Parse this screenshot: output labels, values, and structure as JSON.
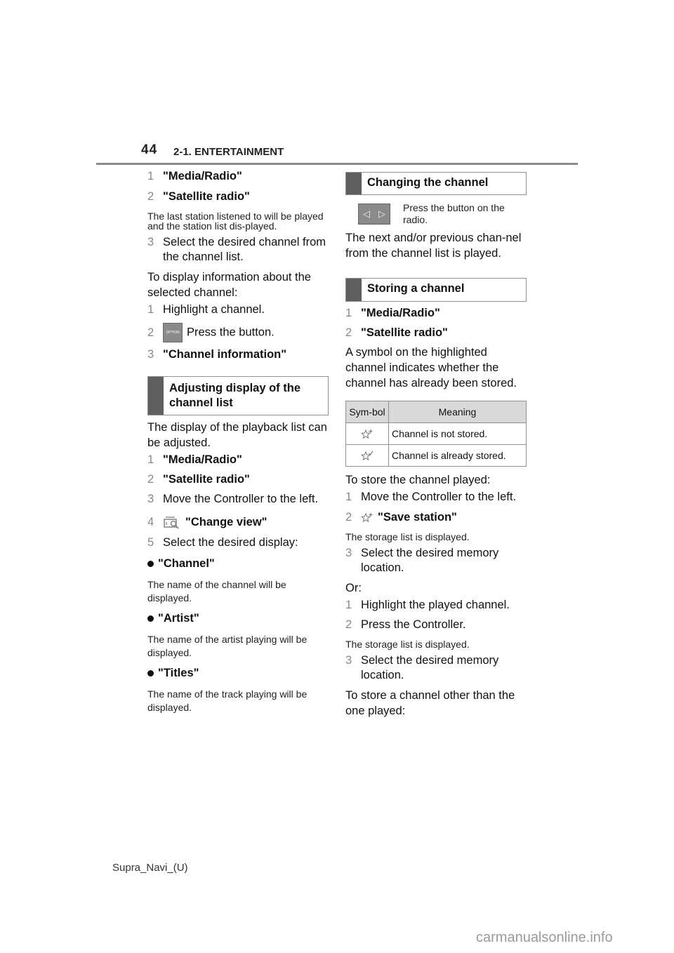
{
  "header": {
    "page_number": "44",
    "section": "2-1. ENTERTAINMENT"
  },
  "left": {
    "steps_a": [
      {
        "num": "1",
        "text": "\"Media/Radio\""
      },
      {
        "num": "2",
        "text": "\"Satellite radio\""
      }
    ],
    "note_a": "The last station listened to will be played and the station list dis-played.",
    "step_a3": {
      "num": "3",
      "text": "Select the desired channel from the channel list."
    },
    "intro_info": "To display information about the selected channel:",
    "info_step1": {
      "num": "1",
      "text": "Highlight a channel."
    },
    "info_step2": {
      "num": "2",
      "icon": "option-button-icon",
      "icon_label": "OPTION",
      "text": "Press the button."
    },
    "info_step3": {
      "num": "3",
      "text": "\"Channel information\""
    },
    "heading_adjust": "Adjusting display of the channel list",
    "adjust_intro": "The display of the playback list can be adjusted.",
    "adjust_steps": [
      {
        "num": "1",
        "text": "\"Media/Radio\""
      },
      {
        "num": "2",
        "text": "\"Satellite radio\""
      },
      {
        "num": "3",
        "text": "Move the Controller to the left."
      }
    ],
    "adjust_step4": {
      "num": "4",
      "icon": "change-view-icon",
      "text": "\"Change view\""
    },
    "adjust_step5": {
      "num": "5",
      "text": "Select the desired display:"
    },
    "options": [
      {
        "label": "\"Channel\"",
        "desc": "The name of the channel will be displayed."
      },
      {
        "label": "\"Artist\"",
        "desc": "The name of the artist playing will be displayed."
      },
      {
        "label": "\"Titles\"",
        "desc": "The name of the track playing will be displayed."
      }
    ]
  },
  "right": {
    "heading_change": "Changing the channel",
    "change_btn_icon": "prev-next-arrows-icon",
    "change_btn_text": "Press the button on the radio.",
    "change_result": "The next and/or previous chan-nel from the channel list is played.",
    "heading_store": "Storing a channel",
    "store_steps": [
      {
        "num": "1",
        "text": "\"Media/Radio\""
      },
      {
        "num": "2",
        "text": "\"Satellite radio\""
      }
    ],
    "store_symbol_intro": "A symbol on the highlighted channel indicates whether the channel has already been stored.",
    "table": {
      "headers": [
        "Sym-bol",
        "Meaning"
      ],
      "rows": [
        {
          "symbol": "star-plus-icon",
          "meaning": "Channel is not stored."
        },
        {
          "symbol": "star-check-icon",
          "meaning": "Channel is already stored."
        }
      ]
    },
    "store_played_intro": "To store the channel played:",
    "store_played_step1": {
      "num": "1",
      "text": "Move the Controller to the left."
    },
    "store_played_step2": {
      "num": "2",
      "icon": "star-plus-icon",
      "text": "\"Save station\""
    },
    "store_note1": "The storage list is displayed.",
    "store_played_step3": {
      "num": "3",
      "text": "Select the desired memory location."
    },
    "or_text": "Or:",
    "or_step1": {
      "num": "1",
      "text": "Highlight the played channel."
    },
    "or_step2": {
      "num": "2",
      "text": "Press the Controller."
    },
    "store_note2": "The storage list is displayed.",
    "or_step3": {
      "num": "3",
      "text": "Select the desired memory location."
    },
    "store_other": "To store a channel other than the one played:"
  },
  "footer": {
    "doc_id": "Supra_Navi_(U)",
    "watermark": "carmanualsonline.info"
  }
}
